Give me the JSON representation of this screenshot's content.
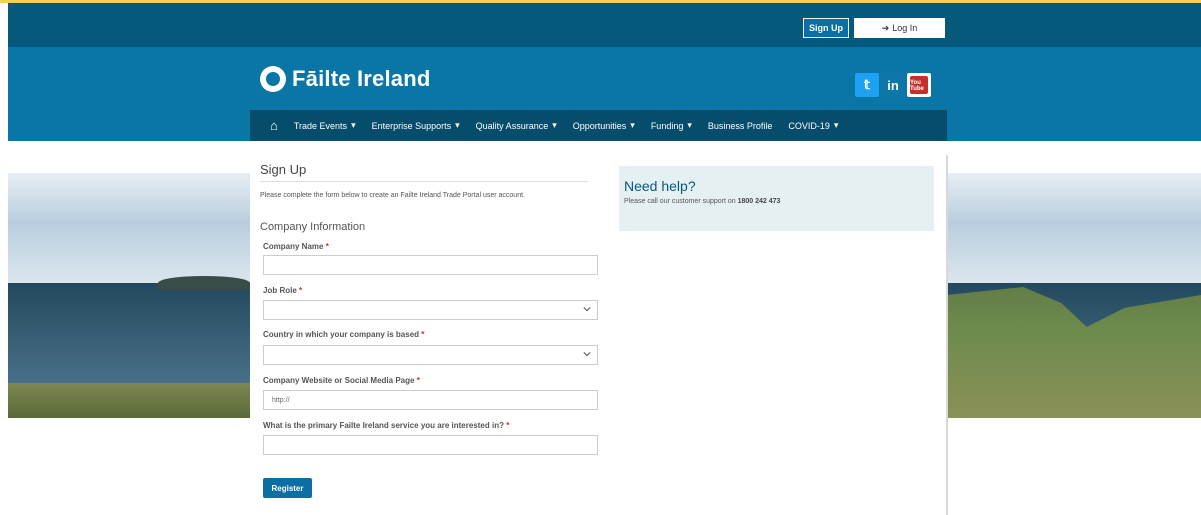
{
  "topbar": {
    "signup_label": "Sign Up",
    "login_label": "Log In",
    "login_icon": "login-arrow-icon"
  },
  "brand": {
    "name": "Fāilte Ireland",
    "logo_icon": "failte-ireland-logo-icon",
    "color": "#0a76a6"
  },
  "social": {
    "twitter_icon": "twitter-icon",
    "linkedin_label": "in",
    "youtube_label": "You Tube"
  },
  "nav": {
    "home_icon": "home-icon",
    "items": [
      {
        "label": "Trade Events",
        "has_caret": true
      },
      {
        "label": "Enterprise Supports",
        "has_caret": true
      },
      {
        "label": "Quality Assurance",
        "has_caret": true
      },
      {
        "label": "Opportunities",
        "has_caret": true
      },
      {
        "label": "Funding",
        "has_caret": true
      },
      {
        "label": "Business Profile",
        "has_caret": false
      },
      {
        "label": "COVID-19",
        "has_caret": true
      }
    ]
  },
  "form": {
    "title": "Sign Up",
    "intro": "Please complete the form below to create an Failte Ireland Trade Portal user account.",
    "section_title": "Company Information",
    "fields": {
      "company_name": {
        "label": "Company Name",
        "value": ""
      },
      "job_role": {
        "label": "Job Role",
        "value": ""
      },
      "country": {
        "label": "Country in which your company is based",
        "value": ""
      },
      "website": {
        "label": "Company Website or Social Media Page",
        "value": "http://"
      },
      "primary_service": {
        "label": "What is the primary Failte Ireland service you are interested in?",
        "value": ""
      }
    },
    "required_marker": "*",
    "register_label": "Register"
  },
  "help": {
    "title": "Need help?",
    "text": "Please call our customer support on ",
    "phone": "1800 242 473"
  }
}
